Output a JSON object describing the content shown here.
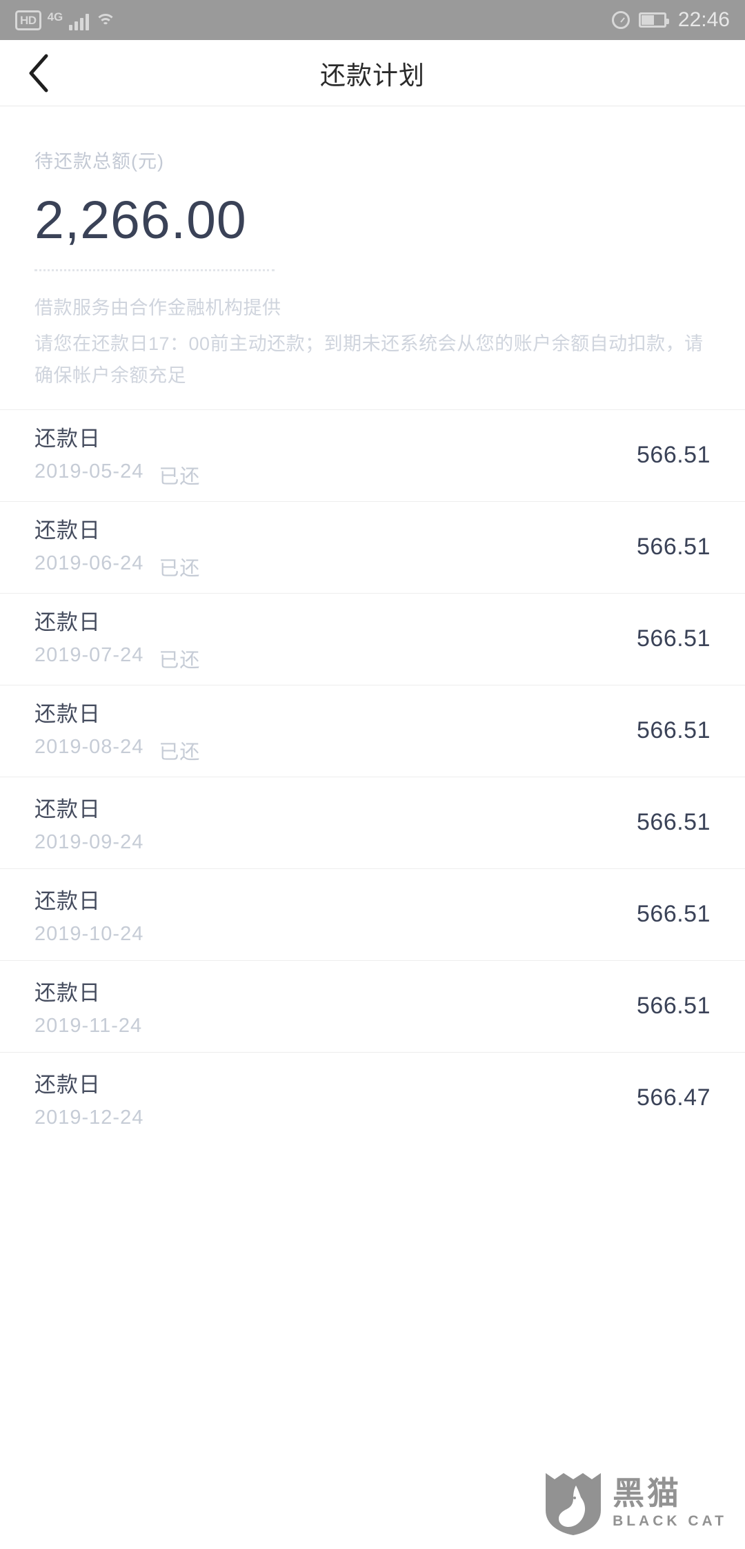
{
  "status_bar": {
    "hd_badge": "HD",
    "network": "4G",
    "icons": [
      "signal-bars-icon",
      "wifi-icon",
      "alarm-icon",
      "battery-icon"
    ],
    "time": "22:46"
  },
  "nav": {
    "back_icon": "chevron-left-icon",
    "title": "还款计划"
  },
  "summary": {
    "label": "待还款总额(元)",
    "amount": "2,266.00",
    "notes": [
      "借款服务由合作金融机构提供",
      "请您在还款日17：00前主动还款；到期未还系统会从您的账户余额自动扣款，请确保帐户余额充足"
    ]
  },
  "list": {
    "title_label": "还款日",
    "rows": [
      {
        "title": "还款日",
        "date": "2019-05-24",
        "status": "已还",
        "amount": "566.51"
      },
      {
        "title": "还款日",
        "date": "2019-06-24",
        "status": "已还",
        "amount": "566.51"
      },
      {
        "title": "还款日",
        "date": "2019-07-24",
        "status": "已还",
        "amount": "566.51"
      },
      {
        "title": "还款日",
        "date": "2019-08-24",
        "status": "已还",
        "amount": "566.51"
      },
      {
        "title": "还款日",
        "date": "2019-09-24",
        "status": "",
        "amount": "566.51"
      },
      {
        "title": "还款日",
        "date": "2019-10-24",
        "status": "",
        "amount": "566.51"
      },
      {
        "title": "还款日",
        "date": "2019-11-24",
        "status": "",
        "amount": "566.51"
      },
      {
        "title": "还款日",
        "date": "2019-12-24",
        "status": "",
        "amount": "566.47"
      }
    ]
  },
  "watermark": {
    "cn": "黑猫",
    "en": "BLACK CAT",
    "icon": "black-cat-shield-icon"
  },
  "colors": {
    "amount_navy": "#3a4257",
    "muted": "#c6ccd6",
    "statusbar_bg": "#9a9a9a"
  }
}
